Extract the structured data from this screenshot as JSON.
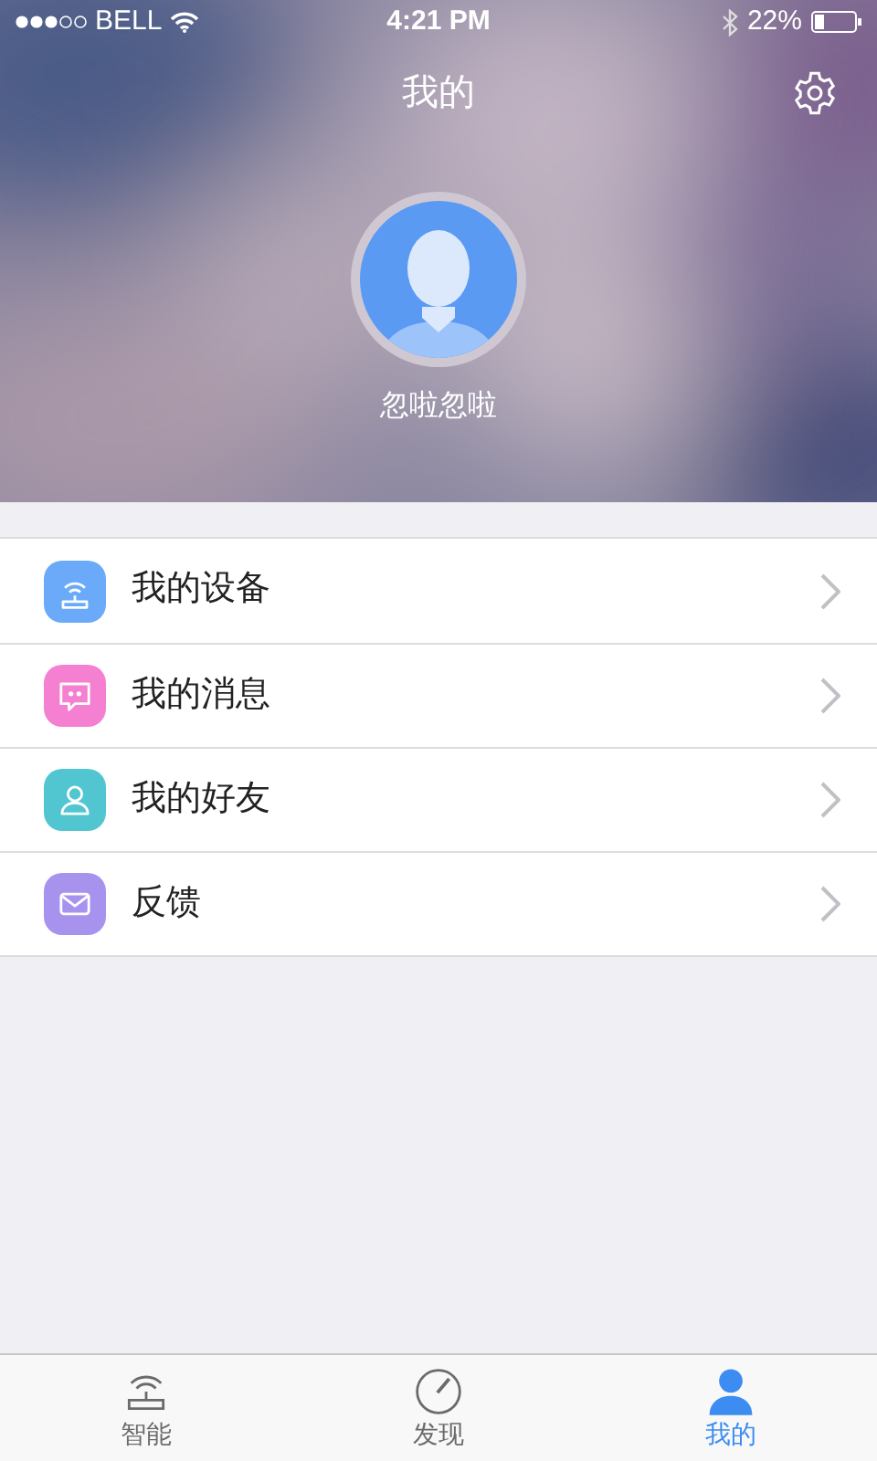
{
  "status_bar": {
    "carrier": "BELL",
    "time": "4:21 PM",
    "battery": "22%"
  },
  "header": {
    "title": "我的",
    "user_name": "忽啦忽啦"
  },
  "menu": [
    {
      "label": "我的设备",
      "kind": "device",
      "color": "#6aaaf8"
    },
    {
      "label": "我的消息",
      "kind": "message",
      "color": "#f57fd0"
    },
    {
      "label": "我的好友",
      "kind": "friend",
      "color": "#52c6d0"
    },
    {
      "label": "反馈",
      "kind": "feedback",
      "color": "#a793ee"
    }
  ],
  "tab_bar": [
    {
      "label": "智能",
      "kind": "device",
      "selected": false
    },
    {
      "label": "发现",
      "kind": "compass",
      "selected": false
    },
    {
      "label": "我的",
      "kind": "person",
      "selected": true
    }
  ]
}
